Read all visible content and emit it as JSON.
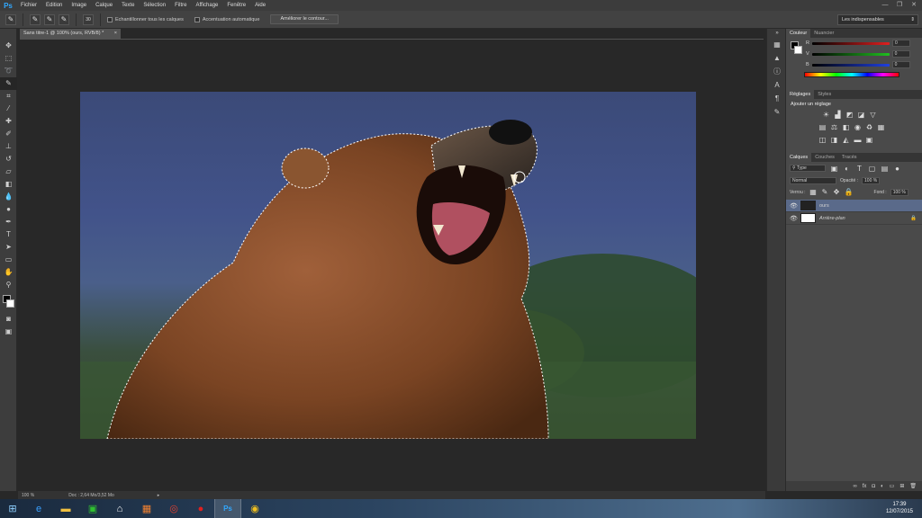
{
  "app": {
    "logo": "Ps",
    "accent": "#31a8ff"
  },
  "menu": [
    "Fichier",
    "Edition",
    "Image",
    "Calque",
    "Texte",
    "Sélection",
    "Filtre",
    "Affichage",
    "Fenêtre",
    "Aide"
  ],
  "window_controls": [
    "—",
    "❐",
    "✕"
  ],
  "options": {
    "brush_size": "30",
    "sample_all": "Echantillonner tous les calques",
    "auto_enhance": "Accentuation automatique",
    "refine": "Améliorer le contour...",
    "workspace": "Les indispensables"
  },
  "document": {
    "tab": "Sans titre-1 @ 100% (ours, RVB/8) *",
    "close": "×"
  },
  "status": {
    "zoom": "100 %",
    "doc": "Doc : 2,64 Mo/3,52 Mo"
  },
  "panels": {
    "color_tabs": [
      "Couleur",
      "Nuancier"
    ],
    "sliders": [
      {
        "label": "R",
        "value": "0",
        "color": "#e02020"
      },
      {
        "label": "V",
        "value": "0",
        "color": "#20c020"
      },
      {
        "label": "B",
        "value": "0",
        "color": "#2040e0"
      }
    ],
    "adj_tabs": [
      "Réglages",
      "Styles"
    ],
    "adj_title": "Ajouter un réglage",
    "layer_tabs": [
      "Calques",
      "Couches",
      "Tracés"
    ],
    "kind": "Type",
    "blend_mode": "Normal",
    "opacity_label": "Opacité :",
    "opacity": "100 %",
    "lock_label": "Verrou :",
    "fill_label": "Fond :",
    "fill": "100 %",
    "layers": [
      {
        "name": "ours",
        "selected": true
      },
      {
        "name": "Arrière-plan",
        "selected": false
      }
    ]
  },
  "taskbar": {
    "time": "17:39",
    "date": "12/07/2015"
  }
}
